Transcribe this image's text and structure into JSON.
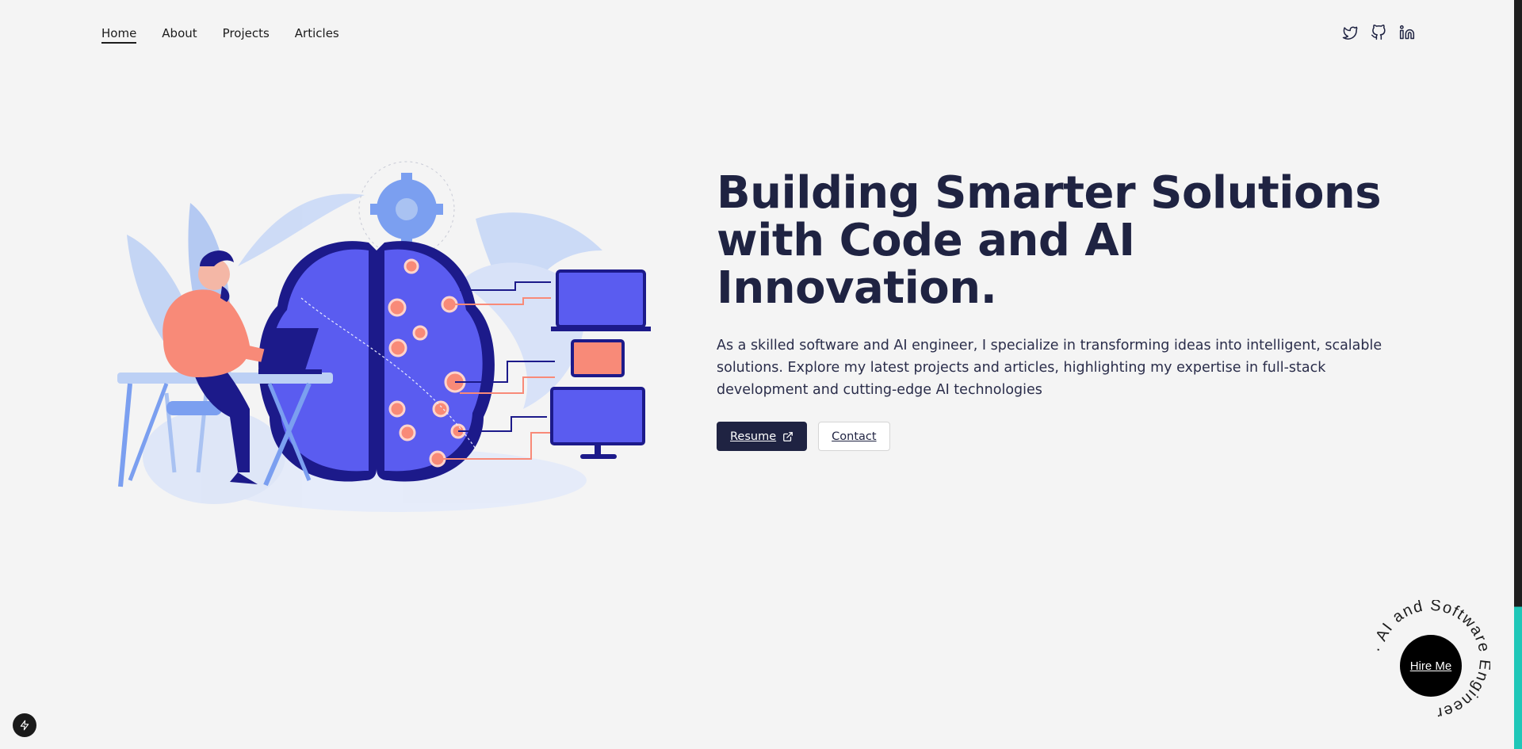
{
  "nav": {
    "items": [
      {
        "label": "Home",
        "active": true
      },
      {
        "label": "About",
        "active": false
      },
      {
        "label": "Projects",
        "active": false
      },
      {
        "label": "Articles",
        "active": false
      }
    ]
  },
  "social": {
    "icons": [
      "twitter-icon",
      "github-icon",
      "linkedin-icon"
    ]
  },
  "hero": {
    "title": "Building Smarter Solutions with Code and AI Innovation.",
    "description": "As a skilled software and AI engineer, I specialize in transforming ideas into intelligent, scalable solutions. Explore my latest projects and articles, highlighting my expertise in full-stack development and cutting-edge AI technologies",
    "resume_label": "Resume",
    "contact_label": "Contact"
  },
  "hire": {
    "label": "Hire Me",
    "ring_text": "· AI and Software Engineer"
  },
  "colors": {
    "primary": "#1f2342",
    "background": "#f4f4f4",
    "accent_teal": "#1fc7b8",
    "illustration_blue": "#5a5cf0",
    "illustration_coral": "#f88a78"
  }
}
